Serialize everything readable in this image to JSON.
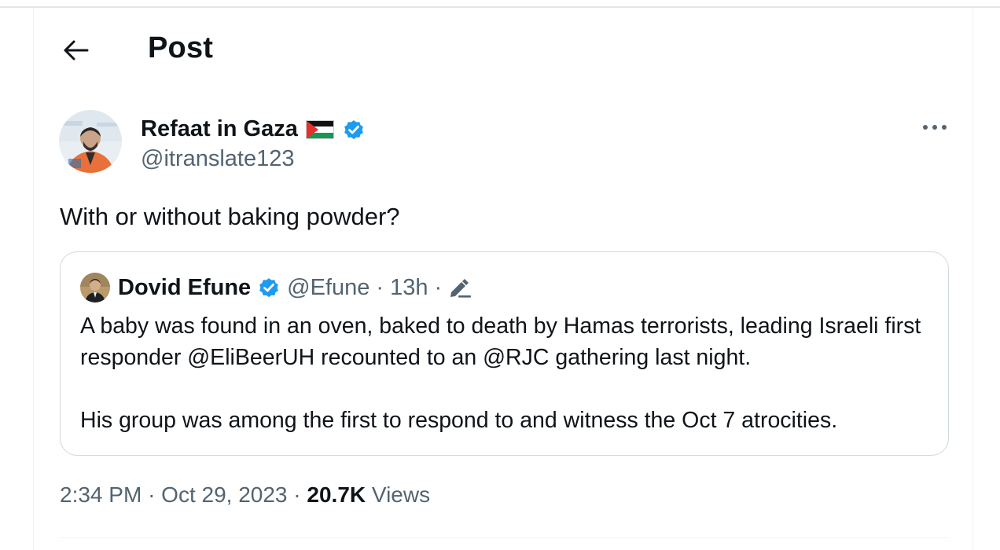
{
  "header": {
    "title": "Post",
    "back_icon": "arrow-left-icon"
  },
  "tweet": {
    "author": {
      "display_name": "Refaat in Gaza",
      "flag": "palestine-flag",
      "verified_icon": "verified-badge-icon",
      "handle": "@itranslate123"
    },
    "more_icon": "more-options-icon",
    "text": "With or without baking powder?",
    "quoted": {
      "display_name": "Dovid Efune",
      "handle": "@Efune",
      "separator": "·",
      "time": "13h",
      "edited_icon": "edit-pencil-icon",
      "paragraphs": [
        "A baby was found in an oven, baked to death by Hamas terrorists, leading Israeli first responder @EliBeerUH recounted to an @RJC gathering last night.",
        "His group was among the first to respond to and witness the Oct 7 atrocities."
      ]
    },
    "meta": {
      "time": "2:34 PM",
      "separator": "·",
      "date": "Oct 29, 2023",
      "views_count": "20.7K",
      "views_label": "Views"
    }
  },
  "colors": {
    "text": "#0f1419",
    "secondary": "#536471",
    "verified": "#1d9bf0",
    "border": "#cfd9de"
  }
}
